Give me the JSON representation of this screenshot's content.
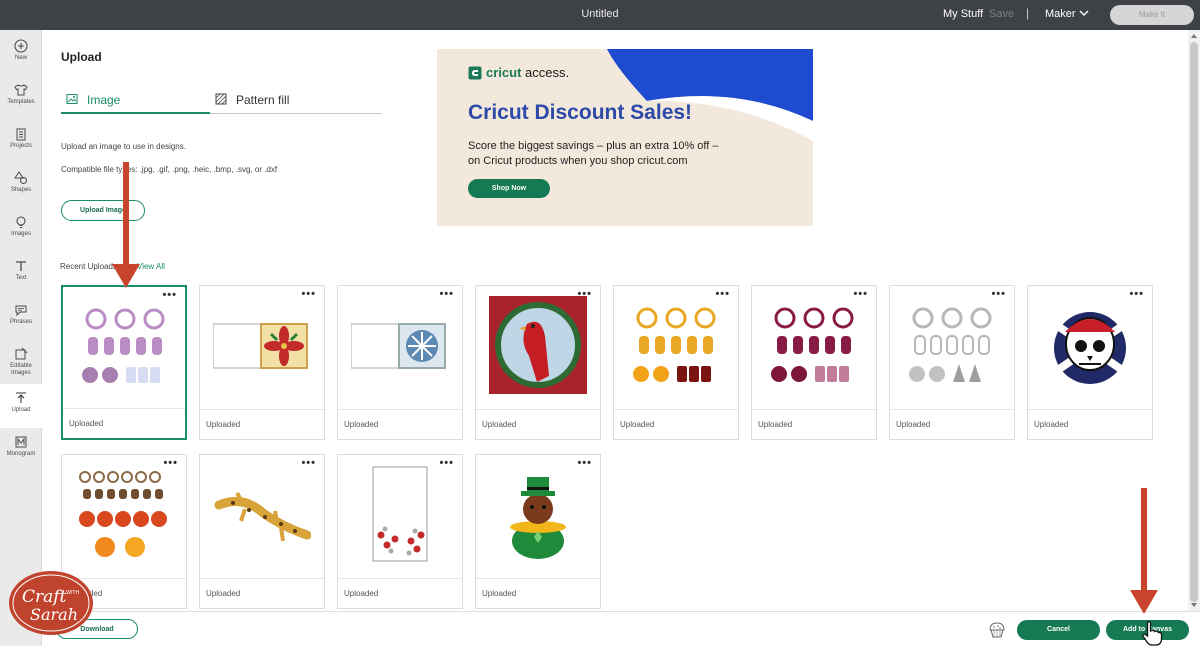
{
  "topbar": {
    "title": "Untitled",
    "my_stuff": "My Stuff",
    "save": "Save",
    "separator": "|",
    "machine": "Maker",
    "make_it": "Make It"
  },
  "sidebar": {
    "items": [
      {
        "label": "New",
        "icon": "plus-circle-icon"
      },
      {
        "label": "Templates",
        "icon": "shirt-icon"
      },
      {
        "label": "Projects",
        "icon": "clipboard-icon"
      },
      {
        "label": "Shapes",
        "icon": "shapes-icon"
      },
      {
        "label": "Images",
        "icon": "lightbulb-icon"
      },
      {
        "label": "Text",
        "icon": "text-icon"
      },
      {
        "label": "Phrases",
        "icon": "speech-bubble-icon"
      },
      {
        "label": "Editable Images",
        "icon": "edit-image-icon"
      },
      {
        "label": "Upload",
        "icon": "upload-icon"
      },
      {
        "label": "Monogram",
        "icon": "monogram-icon"
      }
    ],
    "active": "Upload"
  },
  "panel": {
    "heading": "Upload",
    "tabs": [
      {
        "label": "Image",
        "icon": "image-icon",
        "active": true
      },
      {
        "label": "Pattern fill",
        "icon": "pattern-icon",
        "active": false
      }
    ],
    "description": "Upload an image to use in designs.",
    "compatible": "Compatible file types: .jpg, .gif, .png, .heic, .bmp, .svg, or .dxf",
    "upload_button": "Upload Image",
    "recent_label": "Recent Uploads",
    "view_all": "View All"
  },
  "banner": {
    "brand_prefix": "cricut",
    "brand_suffix": "access.",
    "headline": "Cricut Discount Sales!",
    "line1": "Score the biggest savings – plus an extra 10% off –",
    "line2": "on Cricut products when you shop cricut.com",
    "cta": "Shop Now",
    "colors": {
      "background": "#f3e8dc",
      "accent": "#1f4bd1",
      "headline": "#2d4aa8",
      "cta": "#157a54"
    }
  },
  "uploads": [
    {
      "status": "Uploaded",
      "subject": "lilac ornament set",
      "selected": true
    },
    {
      "status": "Uploaded",
      "subject": "poinsettia tile"
    },
    {
      "status": "Uploaded",
      "subject": "blue snowflake tile"
    },
    {
      "status": "Uploaded",
      "subject": "cardinal in wreath"
    },
    {
      "status": "Uploaded",
      "subject": "gold ornament set"
    },
    {
      "status": "Uploaded",
      "subject": "burgundy ornament set"
    },
    {
      "status": "Uploaded",
      "subject": "silver ornament set"
    },
    {
      "status": "Uploaded",
      "subject": "pirate skull"
    },
    {
      "status": "Uploaded",
      "subject": "autumn ornament set"
    },
    {
      "status": "Uploaded",
      "subject": "gecko"
    },
    {
      "status": "Uploaded",
      "subject": "floral card"
    },
    {
      "status": "Uploaded",
      "subject": "leprechaun dog pot of gold"
    }
  ],
  "card_menu": "•••",
  "footer": {
    "download": "Download",
    "cancel": "Cancel",
    "add_to_canvas": "Add to Canvas"
  },
  "watermark": {
    "text": "Craft with Sarah"
  },
  "colors": {
    "accent": "#1a8d6a",
    "topbar": "#3e4145",
    "annotation_arrow": "#c8442c"
  }
}
